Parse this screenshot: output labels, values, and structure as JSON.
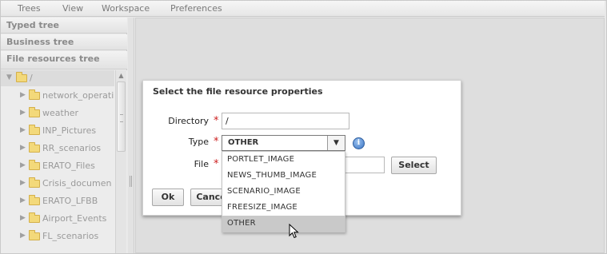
{
  "menubar": {
    "items": [
      "Trees",
      "View",
      "Workspace",
      "Preferences"
    ]
  },
  "leftpanel": {
    "accordion": [
      "Typed tree",
      "Business tree",
      "File resources tree"
    ],
    "tree": {
      "root": "/",
      "children": [
        "network_operati",
        "weather",
        "INP_Pictures",
        "RR_scenarios",
        "ERATO_Files",
        "Crisis_documen",
        "ERATO_LFBB",
        "Airport_Events",
        "FL_scenarios"
      ]
    }
  },
  "dialog": {
    "title": "Select the file resource properties",
    "directory_label": "Directory",
    "directory_value": "/",
    "type_label": "Type",
    "type_value": "OTHER",
    "file_label": "File",
    "file_value": "",
    "select_button": "Select",
    "ok_button": "Ok",
    "cancel_button": "Cance",
    "info_glyph": "i",
    "required_marker": "*"
  },
  "dropdown": {
    "options": [
      "PORTLET_IMAGE",
      "NEWS_THUMB_IMAGE",
      "SCENARIO_IMAGE",
      "FREESIZE_IMAGE",
      "OTHER"
    ],
    "selected": "OTHER"
  },
  "icons": {
    "folder": "folder-icon",
    "info": "info-icon",
    "dropdown_arrow": "chevron-down-icon",
    "cursor": "mouse-pointer-icon"
  },
  "colors": {
    "required": "#cc1f1f",
    "selected_option": "#c9c9c9",
    "folder": "#f3d97a",
    "info": "#3a74c4"
  }
}
